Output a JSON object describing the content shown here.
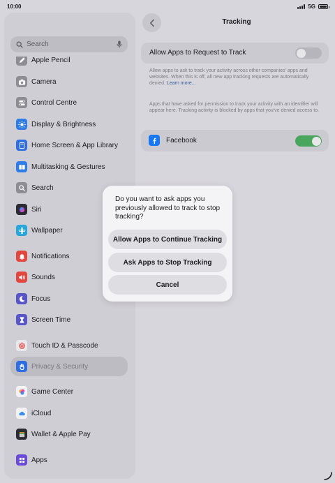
{
  "status": {
    "time": "10:00",
    "network": "5G"
  },
  "sidebar": {
    "search_placeholder": "Search",
    "items": [
      {
        "label": "Apple Pencil",
        "icon": "pencil-icon",
        "color": "#8e8d94"
      },
      {
        "label": "Camera",
        "icon": "camera-icon",
        "color": "#8e8d94"
      },
      {
        "label": "Control Centre",
        "icon": "control-centre-icon",
        "color": "#8e8d94"
      },
      {
        "label": "Display & Brightness",
        "icon": "brightness-icon",
        "color": "#2f7be8"
      },
      {
        "label": "Home Screen & App Library",
        "icon": "home-screen-icon",
        "color": "#2f6ee0"
      },
      {
        "label": "Multitasking & Gestures",
        "icon": "multitasking-icon",
        "color": "#2f7be8"
      },
      {
        "label": "Search",
        "icon": "search-icon",
        "color": "#8e8d94"
      },
      {
        "label": "Siri",
        "icon": "siri-icon",
        "color": "#2b2b33"
      },
      {
        "label": "Wallpaper",
        "icon": "wallpaper-icon",
        "color": "#28a6d9"
      },
      {
        "label": "Notifications",
        "icon": "bell-icon",
        "color": "#e2473f"
      },
      {
        "label": "Sounds",
        "icon": "speaker-icon",
        "color": "#e2473f"
      },
      {
        "label": "Focus",
        "icon": "moon-icon",
        "color": "#5856c6"
      },
      {
        "label": "Screen Time",
        "icon": "hourglass-icon",
        "color": "#5856c6"
      },
      {
        "label": "Touch ID & Passcode",
        "icon": "fingerprint-icon",
        "color": "#e8e8ec"
      },
      {
        "label": "Privacy & Security",
        "icon": "hand-icon",
        "color": "#2f6ee0"
      },
      {
        "label": "Game Center",
        "icon": "game-center-icon",
        "color": "#f2f2f5"
      },
      {
        "label": "iCloud",
        "icon": "cloud-icon",
        "color": "#f2f2f5"
      },
      {
        "label": "Wallet & Apple Pay",
        "icon": "wallet-icon",
        "color": "#2b2b33"
      },
      {
        "label": "Apps",
        "icon": "apps-grid-icon",
        "color": "#6a4bd8"
      }
    ]
  },
  "main": {
    "title": "Tracking",
    "allow_request_label": "Allow Apps to Request to Track",
    "allow_request_on": false,
    "footnote1": "Allow apps to ask to track your activity across other companies' apps and websites. When this is off, all new app tracking requests are automatically denied.",
    "footnote1_link": "Learn more...",
    "footnote2": "Apps that have asked for permission to track your activity with an identifier will appear here. Tracking activity is blocked by apps that you've denied access to.",
    "facebook_label": "Facebook",
    "facebook_on": true
  },
  "alert": {
    "message": "Do you want to ask apps you previously allowed to track to stop tracking?",
    "continue_label": "Allow Apps to Continue Tracking",
    "stop_label": "Ask Apps to Stop Tracking",
    "cancel_label": "Cancel"
  },
  "colors": {
    "toggle_on": "#4aa65c",
    "toggle_off": "#b6b5bb",
    "facebook_blue": "#1877f2"
  }
}
